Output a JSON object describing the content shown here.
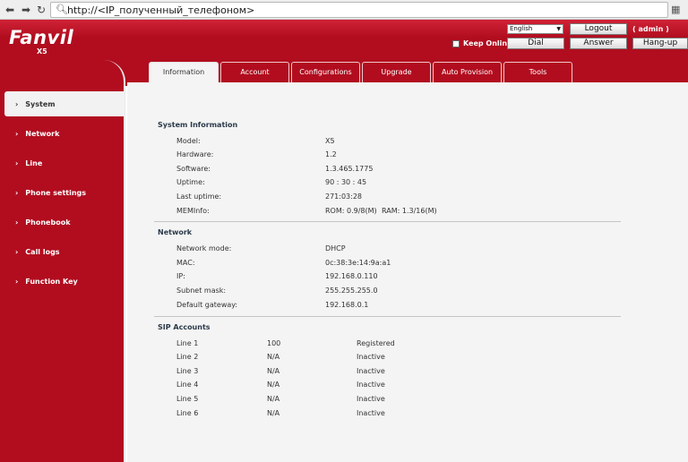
{
  "browser": {
    "back_icon": "arrow-left-icon",
    "forward_icon": "arrow-right-icon",
    "reload_icon": "reload-icon",
    "url": "http://<IP_полученный_телефоном>"
  },
  "header": {
    "logo": "Fanvil",
    "model": "X5",
    "language": "English",
    "logout_label": "Logout",
    "user": "( admin )",
    "keep_online_label": "Keep Online",
    "dial_label": "Dial",
    "answer_label": "Answer",
    "hangup_label": "Hang-up"
  },
  "sidebar": {
    "items": [
      {
        "label": "System"
      },
      {
        "label": "Network"
      },
      {
        "label": "Line"
      },
      {
        "label": "Phone settings"
      },
      {
        "label": "Phonebook"
      },
      {
        "label": "Call logs"
      },
      {
        "label": "Function Key"
      }
    ]
  },
  "tabs": [
    {
      "label": "Information"
    },
    {
      "label": "Account"
    },
    {
      "label": "Configurations"
    },
    {
      "label": "Upgrade"
    },
    {
      "label": "Auto Provision"
    },
    {
      "label": "Tools"
    }
  ],
  "system_info": {
    "title": "System Information",
    "rows": [
      {
        "label": "Model:",
        "value": "X5"
      },
      {
        "label": "Hardware:",
        "value": "1.2"
      },
      {
        "label": "Software:",
        "value": "1.3.465.1775"
      },
      {
        "label": "Uptime:",
        "value": "90 : 30 : 45"
      },
      {
        "label": "Last uptime:",
        "value": "271:03:28"
      },
      {
        "label": "MEMInfo:",
        "value": "ROM: 0.9/8(M)",
        "value2": "RAM: 1.3/16(M)"
      }
    ]
  },
  "network": {
    "title": "Network",
    "rows": [
      {
        "label": "Network mode:",
        "value": "DHCP"
      },
      {
        "label": "MAC:",
        "value": "0c:38:3e:14:9a:a1"
      },
      {
        "label": "IP:",
        "value": "192.168.0.110"
      },
      {
        "label": "Subnet mask:",
        "value": "255.255.255.0"
      },
      {
        "label": "Default gateway:",
        "value": "192.168.0.1"
      }
    ]
  },
  "sip": {
    "title": "SIP Accounts",
    "rows": [
      {
        "line": "Line 1",
        "number": "100",
        "status": "Registered"
      },
      {
        "line": "Line 2",
        "number": "N/A",
        "status": "Inactive"
      },
      {
        "line": "Line 3",
        "number": "N/A",
        "status": "Inactive"
      },
      {
        "line": "Line 4",
        "number": "N/A",
        "status": "Inactive"
      },
      {
        "line": "Line 5",
        "number": "N/A",
        "status": "Inactive"
      },
      {
        "line": "Line 6",
        "number": "N/A",
        "status": "Inactive"
      }
    ]
  }
}
